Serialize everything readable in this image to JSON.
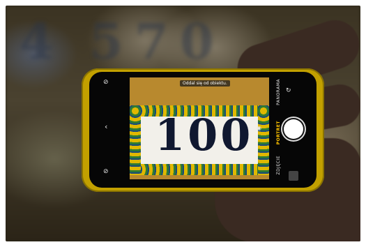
{
  "background_digits": [
    "4",
    "5",
    "7",
    "0"
  ],
  "photo": {
    "phone_color": "#c2a000",
    "hint_text": "Oddal się od obiektu.",
    "tile_number": "100",
    "camera_modes": [
      "ZDJĘCIE",
      "PORTRET",
      "PANORAMA"
    ],
    "active_mode": "PORTRET",
    "icons": [
      "flash-icon",
      "chevron-left-icon",
      "live-photo-icon",
      "switch-camera-icon",
      "zoom-icon",
      "shutter-button"
    ]
  }
}
